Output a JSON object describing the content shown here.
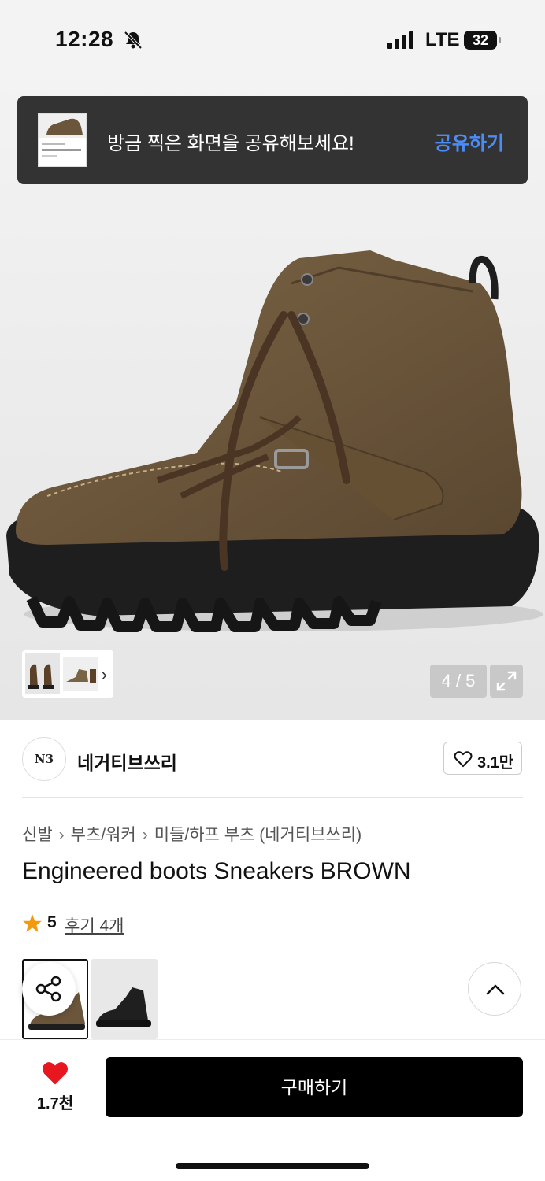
{
  "status_bar": {
    "time": "12:28",
    "network": "LTE",
    "battery": "32"
  },
  "toast": {
    "message": "방금 찍은 화면을 공유해보세요!",
    "action": "공유하기"
  },
  "gallery": {
    "counter": "4 / 5"
  },
  "brand": {
    "logo_text": "N3",
    "name": "네거티브쓰리",
    "likes": "3.1만"
  },
  "breadcrumb": [
    "신발",
    "부츠/워커",
    "미들/하프 부츠 (네거티브쓰리)"
  ],
  "product": {
    "title": "Engineered boots Sneakers BROWN",
    "rating": "5",
    "reviews": "후기 4개"
  },
  "bottom": {
    "wish_count": "1.7천",
    "buy_label": "구매하기"
  },
  "colors": {
    "accent_blue": "#4b8df8",
    "heart_red": "#e8161f",
    "star": "#f29a0f",
    "buy_bg": "#000000"
  }
}
